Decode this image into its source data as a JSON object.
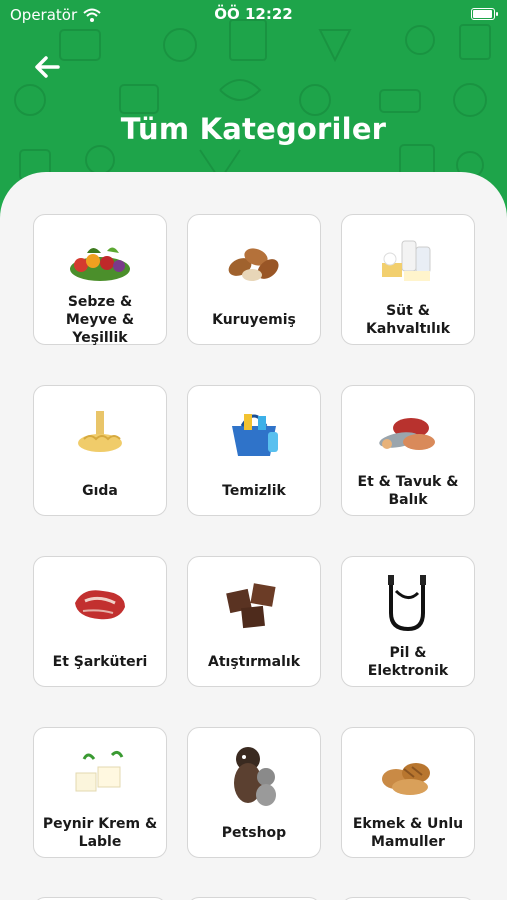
{
  "status_bar": {
    "carrier": "Operatör",
    "time": "ÖÖ 12:22",
    "battery_level": 1.0
  },
  "header": {
    "title": "Tüm Kategoriler",
    "back_icon": "arrow-left-icon"
  },
  "colors": {
    "brand_green": "#1ea44a",
    "background": "#f5f5f5"
  },
  "categories": [
    {
      "label": "Sebze & Meyve & Yeşillik",
      "icon": "vegetables-icon"
    },
    {
      "label": "Kuruyemiş",
      "icon": "almonds-icon"
    },
    {
      "label": "Süt & Kahvaltılık",
      "icon": "dairy-icon"
    },
    {
      "label": "Gıda",
      "icon": "pasta-icon"
    },
    {
      "label": "Temizlik",
      "icon": "cleaning-bucket-icon"
    },
    {
      "label": "Et & Tavuk & Balık",
      "icon": "meat-fish-icon"
    },
    {
      "label": "Et Şarküteri",
      "icon": "red-meat-icon"
    },
    {
      "label": "Atıştırmalık",
      "icon": "chocolate-icon"
    },
    {
      "label": "Pil & Elektronik",
      "icon": "usb-cable-icon"
    },
    {
      "label": "Peynir Krem & Lable",
      "icon": "cheese-icon"
    },
    {
      "label": "Petshop",
      "icon": "pets-icon"
    },
    {
      "label": "Ekmek & Unlu Mamuller",
      "icon": "bread-icon"
    }
  ]
}
